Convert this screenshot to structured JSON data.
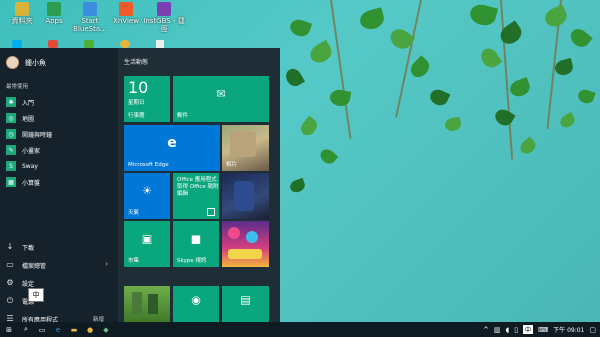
{
  "desktop": {
    "icons": [
      {
        "label": "資料夾",
        "color": "#d9b23a"
      },
      {
        "label": "Apps",
        "color": "#2a9d4f"
      },
      {
        "label": "Start BlueSta...",
        "color": "#3b8de0"
      },
      {
        "label": "XnView",
        "color": "#f05a28"
      },
      {
        "label": "InstGBS - 捷徑",
        "color": "#7b3fb4"
      }
    ]
  },
  "start_menu": {
    "user_name": "鍾小魚",
    "most_used_label": "最常使用",
    "apps": [
      {
        "label": "入門",
        "icon": "bulb-icon",
        "glyph": "✱"
      },
      {
        "label": "地圖",
        "icon": "map-icon",
        "glyph": "◎"
      },
      {
        "label": "鬧鐘與時鐘",
        "icon": "alarm-icon",
        "glyph": "◷"
      },
      {
        "label": "小畫家",
        "icon": "paint-icon",
        "glyph": "✎"
      },
      {
        "label": "Sway",
        "icon": "sway-icon",
        "glyph": "S"
      },
      {
        "label": "小算盤",
        "icon": "calculator-icon",
        "glyph": "▦"
      }
    ],
    "bottom": {
      "downloads": "下載",
      "file_explorer": "檔案總管",
      "settings": "設定",
      "power": "電源",
      "all_apps": "所有應用程式",
      "new_badge": "新增"
    },
    "ime_popup": "中",
    "group_label": "生活動態",
    "tiles": {
      "calendar_number": "10",
      "calendar_day": "星期日",
      "calendar_label": "行事曆",
      "mail_label": "郵件",
      "edge_label": "Microsoft Edge",
      "photos_label": "相片",
      "weather_label": "天氣",
      "office_text": "Office 應用程式 取得 Office 隨附 編輯",
      "store_label": "市集",
      "skype_label": "Skype 視訊"
    }
  },
  "taskbar": {
    "ime": "中",
    "time": "下午 09:01"
  }
}
